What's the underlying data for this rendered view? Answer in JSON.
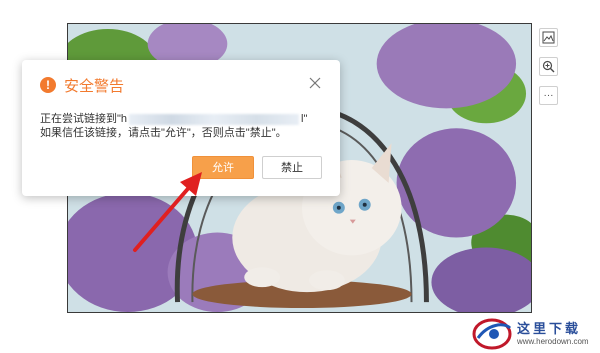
{
  "dialog": {
    "title": "安全警告",
    "warning_glyph": "!",
    "message_prefix": "正在尝试链接到\"h",
    "message_suffix": "l\"",
    "message_line2": "如果信任该链接，请点击\"允许\"，否则点击\"禁止\"。",
    "allow_label": "允许",
    "deny_label": "禁止",
    "close_glyph": "×"
  },
  "toolbar": {
    "icons": [
      "image-icon",
      "zoom-in-icon",
      "more-icon"
    ],
    "more_glyph": "···"
  },
  "watermark": {
    "brand_text": "这里下载",
    "url": "www.herodown.com"
  },
  "colors": {
    "accent": "#f27a2e",
    "allow_button": "#f7a04a",
    "arrow": "#e02020"
  }
}
